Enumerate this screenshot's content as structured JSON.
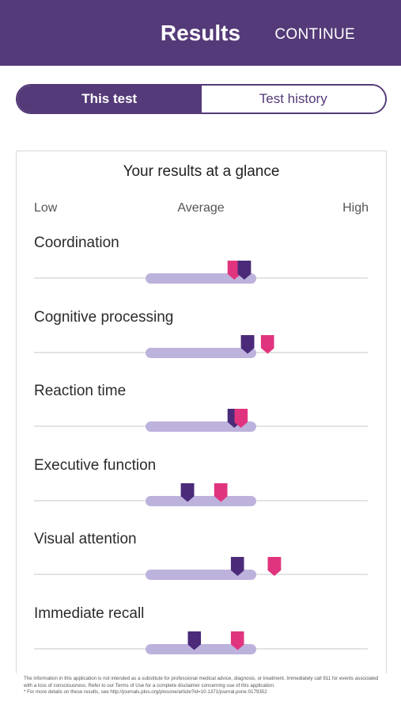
{
  "header": {
    "title": "Results",
    "continue_label": "CONTINUE"
  },
  "tabs": [
    {
      "label": "This test",
      "active": true
    },
    {
      "label": "Test history",
      "active": false
    }
  ],
  "card": {
    "heading": "Your results at a glance",
    "scale": {
      "low": "Low",
      "average": "Average",
      "high": "High"
    },
    "average_band_range": [
      0.333,
      0.665
    ]
  },
  "colors": {
    "header_bg": "#543a78",
    "previous_marker": "#4b2a7a",
    "current_marker": "#e0357e",
    "average_band": "#bdb2dc"
  },
  "metrics": [
    {
      "label": "Coordination",
      "previous": 0.63,
      "current": 0.6
    },
    {
      "label": "Cognitive processing",
      "previous": 0.64,
      "current": 0.7
    },
    {
      "label": "Reaction time",
      "previous": 0.6,
      "current": 0.62
    },
    {
      "label": "Executive function",
      "previous": 0.46,
      "current": 0.56
    },
    {
      "label": "Visual attention",
      "previous": 0.61,
      "current": 0.72
    },
    {
      "label": "Immediate recall",
      "previous": 0.48,
      "current": 0.61
    }
  ],
  "footer": {
    "disclaimer": "The information in this application is not intended as a substitute for professional medical advice, diagnosis, or treatment. Immediately call 911 for events associated with a loss of consciousness. Refer to our Terms of Use for a complete disclaimer concerning use of this application.",
    "reference": "* For more details on these results, see http://journals.plos.org/plosone/article?id=10.1371/journal.pone.0179352"
  }
}
